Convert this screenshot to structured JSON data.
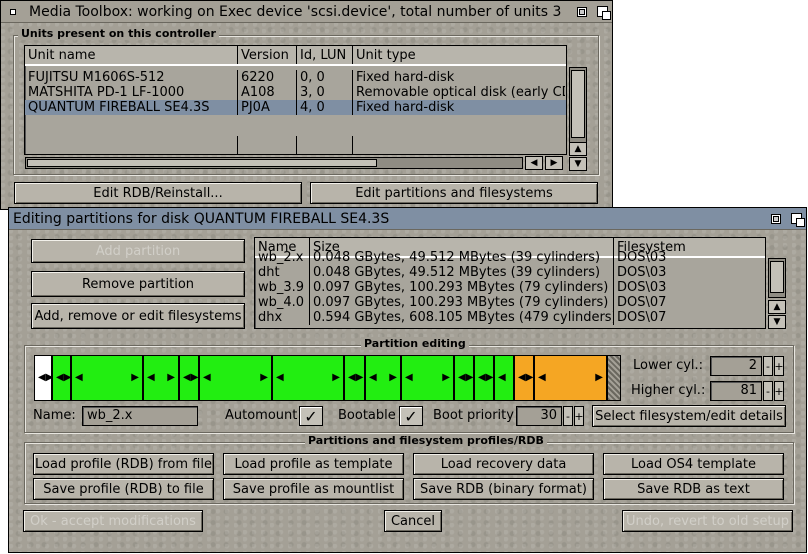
{
  "main_window": {
    "title": "Media Toolbox: working on Exec device 'scsi.device', total number of units 3"
  },
  "units_group": {
    "label": "Units present on this controller",
    "columns": [
      "Unit name",
      "Version",
      "Id, LUN",
      "Unit type"
    ],
    "rows": [
      {
        "name": "FUJITSU  M1606S-512",
        "version": "6220",
        "id": "0, 0",
        "type": "Fixed hard-disk"
      },
      {
        "name": "MATSHITA PD-1 LF-1000",
        "version": "A108",
        "id": "3, 0",
        "type": "Removable optical disk (early CD"
      },
      {
        "name": "QUANTUM  FIREBALL SE4.3S",
        "version": "PJ0A",
        "id": "4, 0",
        "type": "Fixed hard-disk",
        "selected": true
      }
    ],
    "edit_rdb_button": "Edit RDB/Reinstall...",
    "edit_partitions_button": "Edit partitions and filesystems"
  },
  "partition_window": {
    "title": "Editing partitions for disk QUANTUM  FIREBALL SE4.3S",
    "add_partition": "Add partition",
    "remove_partition": "Remove partition",
    "edit_filesystems": "Add, remove or edit filesystems",
    "list_columns": [
      "Name",
      "Size",
      "Filesystem"
    ],
    "list_rows": [
      {
        "name": "wb_2.x",
        "size": "0.048 GBytes, 49.512 MBytes (39 cylinders)",
        "fs": "DOS\\03"
      },
      {
        "name": "dht",
        "size": "0.048 GBytes, 49.512 MBytes (39 cylinders)",
        "fs": "DOS\\03"
      },
      {
        "name": "wb_3.9",
        "size": "0.097 GBytes, 100.293 MBytes (79 cylinders)",
        "fs": "DOS\\03"
      },
      {
        "name": "wb_4.0",
        "size": "0.097 GBytes, 100.293 MBytes (79 cylinders)",
        "fs": "DOS\\07"
      },
      {
        "name": "dhx",
        "size": "0.594 GBytes, 608.105 MBytes (479 cylinders)",
        "fs": "DOS\\07"
      }
    ],
    "partition_editing": {
      "label": "Partition editing",
      "lower_cyl_label": "Lower cyl.:",
      "lower_cyl_value": "2",
      "higher_cyl_label": "Higher cyl.:",
      "higher_cyl_value": "81",
      "name_label": "Name:",
      "name_value": "wb_2.x",
      "automount_label": "Automount",
      "bootable_label": "Bootable",
      "boot_priority_label": "Boot priority",
      "boot_priority_value": "30",
      "select_fs_button": "Select filesystem/edit details",
      "check_glyph": "✓",
      "minus": "-",
      "plus": "+"
    },
    "profiles": {
      "label": "Partitions and filesystem profiles/RDB",
      "buttons": [
        "Load profile (RDB) from file",
        "Load profile as template",
        "Load recovery data",
        "Load OS4 template",
        "Save profile (RDB) to file",
        "Save profile as mountlist",
        "Save RDB (binary format)",
        "Save RDB as text"
      ]
    },
    "ok_button": "Ok - accept modifications",
    "cancel_button": "Cancel",
    "undo_button": "Undo, revert to old setup"
  },
  "colors": {
    "window_bg": "#a4a096",
    "active_title": "#7f8fa3",
    "partition_green": "#22ee11",
    "partition_selected": "#f5a623"
  }
}
